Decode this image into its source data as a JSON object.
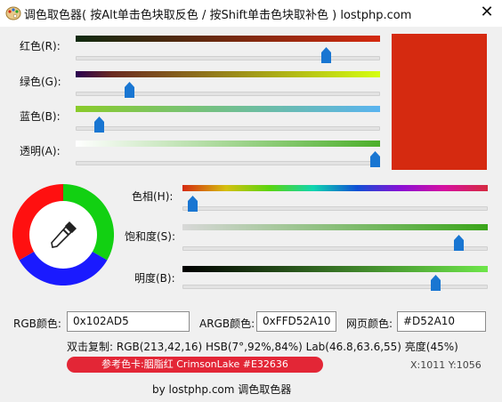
{
  "window": {
    "title": "调色取色器( 按Alt单击色块取反色 / 按Shift单击色块取补色 ) lostphp.com",
    "close_glyph": "✕"
  },
  "sliders": [
    {
      "label": "红色(R):",
      "value": 213,
      "max": 255,
      "gradient": [
        "#102A10",
        "#D52A10"
      ]
    },
    {
      "label": "绿色(G):",
      "value": 42,
      "max": 255,
      "gradient": [
        "#D50010",
        "#D5FF10"
      ]
    },
    {
      "label": "蓝色(B):",
      "value": 16,
      "max": 255,
      "gradient": [
        "#8ACB2A",
        "#5AB4F0"
      ]
    },
    {
      "label": "透明(A):",
      "value": 255,
      "max": 255,
      "gradient": [
        "#FFFFFF",
        "#4CAF2A"
      ]
    }
  ],
  "hsb_sliders": [
    {
      "label": "色相(H):",
      "value": 7,
      "max": 360
    },
    {
      "label": "饱和度(S):",
      "value": 92,
      "max": 100
    },
    {
      "label": "明度(B):",
      "value": 84,
      "max": 100
    }
  ],
  "current_color": "#D52A10",
  "fields": {
    "rgb_label": "RGB颜色:",
    "rgb_value": "0x102AD5",
    "argb_label": "ARGB颜色:",
    "argb_value": "0xFFD52A10",
    "web_label": "网页颜色:",
    "web_value": "#D52A10"
  },
  "copy_info": "双击复制: RGB(213,42,16) HSB(7°,92%,84%) Lab(46.8,63.6,55) 亮度(45%)",
  "reference": {
    "text": "参考色卡:胭脂红  CrimsonLake  #E32636",
    "color": "#E32636"
  },
  "coords": "X:1011  Y:1056",
  "footer": "by lostphp.com 调色取色器",
  "icons": {
    "app": "palette-icon",
    "eyedropper": "eyedropper-icon"
  }
}
